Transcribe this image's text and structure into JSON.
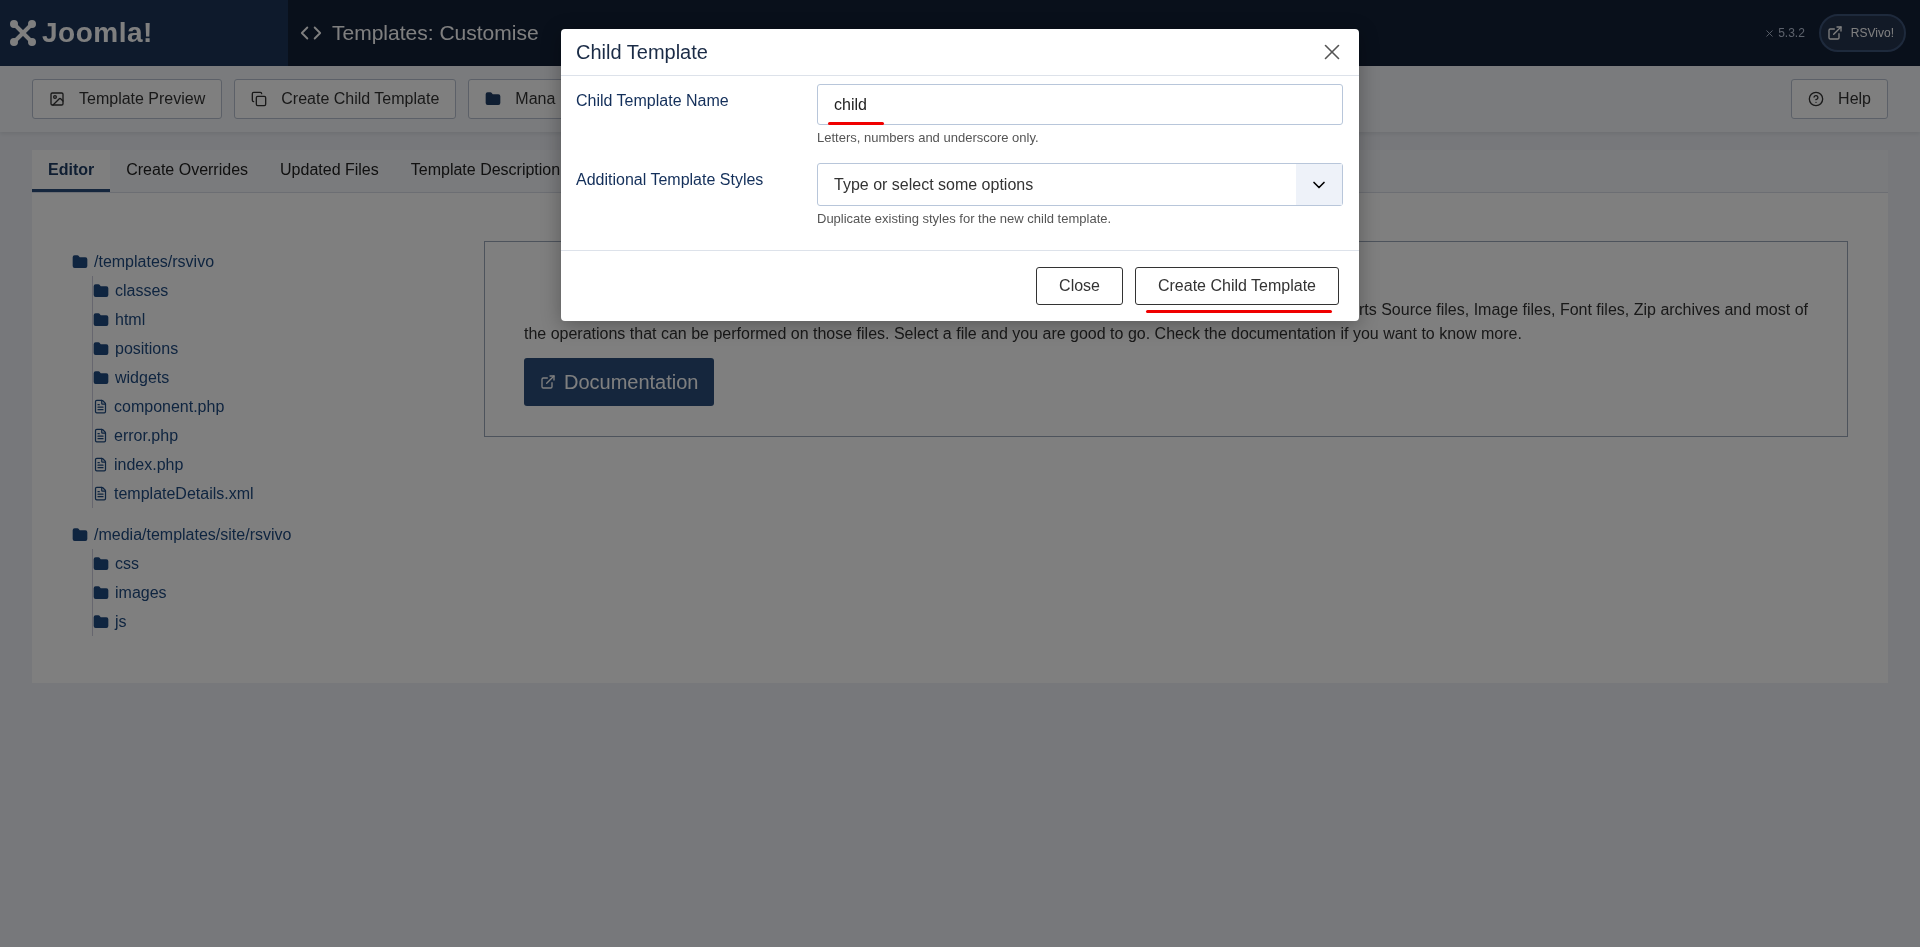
{
  "header": {
    "logo": "Joomla!",
    "title": "Templates: Customise",
    "version": "5.3.2",
    "site_button": "RSVivo!"
  },
  "toolbar": {
    "buttons": [
      {
        "label": "Template Preview",
        "kind": "image"
      },
      {
        "label": "Create Child Template",
        "kind": "copy"
      },
      {
        "label": "Mana",
        "kind": "folder"
      }
    ],
    "help": "Help"
  },
  "tabs": [
    {
      "label": "Editor",
      "selected": true
    },
    {
      "label": "Create Overrides",
      "selected": false
    },
    {
      "label": "Updated Files",
      "selected": false
    },
    {
      "label": "Template Description",
      "selected": false
    }
  ],
  "tree": [
    {
      "name": "/templates/rsvivo",
      "kind": "folder",
      "children": [
        {
          "name": "classes",
          "kind": "folder"
        },
        {
          "name": "html",
          "kind": "folder"
        },
        {
          "name": "positions",
          "kind": "folder"
        },
        {
          "name": "widgets",
          "kind": "folder"
        },
        {
          "name": "component.php",
          "kind": "file"
        },
        {
          "name": "error.php",
          "kind": "file"
        },
        {
          "name": "index.php",
          "kind": "file"
        },
        {
          "name": "templateDetails.xml",
          "kind": "file"
        }
      ]
    },
    {
      "name": "/media/templates/site/rsvivo",
      "kind": "folder",
      "children": [
        {
          "name": "css",
          "kind": "folder"
        },
        {
          "name": "images",
          "kind": "folder"
        },
        {
          "name": "js",
          "kind": "folder"
        }
      ]
    }
  ],
  "description": {
    "line_1": "rts Source files, Image files, Font files, Zip archives and most of",
    "line_2": "the operations that can be performed on those files. Select a file and you are good to go. Check the documentation if you want to know more.",
    "button": "Documentation"
  },
  "modal": {
    "title": "Child Template",
    "fields": [
      {
        "label": "Child Template Name",
        "kind": "text",
        "value": "child",
        "hint": "Letters, numbers and underscore only.",
        "highlighted": true
      },
      {
        "label": "Additional Template Styles",
        "kind": "select",
        "placeholder": "Type or select some options",
        "hint": "Duplicate existing styles for the new child template."
      }
    ],
    "buttons": [
      {
        "label": "Close"
      },
      {
        "label": "Create Child Template",
        "highlighted": true
      }
    ]
  }
}
